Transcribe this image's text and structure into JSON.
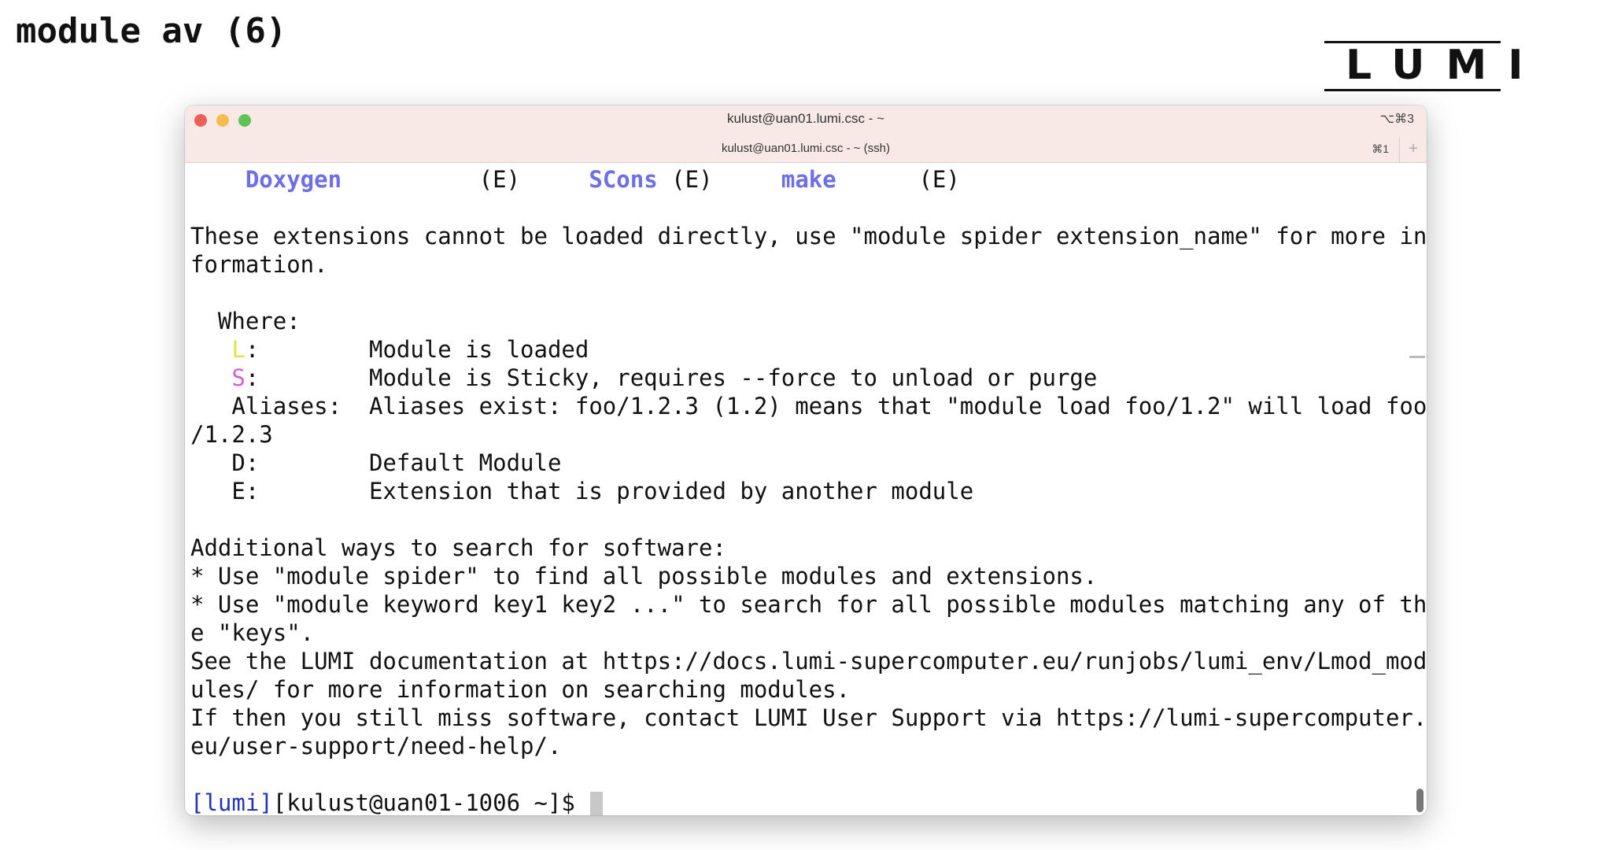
{
  "slide": {
    "title": "module av (6)",
    "logo": "LUMI"
  },
  "window": {
    "title": "kulust@uan01.lumi.csc - ~",
    "shortcut": "⌥⌘3",
    "tab": {
      "title": "kulust@uan01.lumi.csc - ~ (ssh)",
      "shortcut": "⌘1",
      "add": "+"
    }
  },
  "terminal": {
    "ext_items": [
      {
        "name": "Doxygen",
        "tag": "(E)"
      },
      {
        "name": "SCons",
        "tag": "(E)"
      },
      {
        "name": "make",
        "tag": "(E)"
      }
    ],
    "lines": [
      "These extensions cannot be loaded directly, use \"module spider extension_name\" for more in",
      "formation.",
      "",
      "  Where:",
      "   L:        Module is loaded",
      "   S:        Module is Sticky, requires --force to unload or purge",
      "   Aliases:  Aliases exist: foo/1.2.3 (1.2) means that \"module load foo/1.2\" will load foo",
      "/1.2.3",
      "   D:        Default Module",
      "   E:        Extension that is provided by another module",
      "",
      "Additional ways to search for software:",
      "* Use \"module spider\" to find all possible modules and extensions.",
      "* Use \"module keyword key1 key2 ...\" to search for all possible modules matching any of th",
      "e \"keys\".",
      "See the LUMI documentation at https://docs.lumi-supercomputer.eu/runjobs/lumi_env/Lmod_mod",
      "ules/ for more information on searching modules.",
      "If then you still miss software, contact LUMI User Support via https://lumi-supercomputer.",
      "eu/user-support/need-help/.",
      ""
    ],
    "legend_letter_L": "L",
    "legend_letter_S": "S",
    "prompt": {
      "lumi": "[lumi]",
      "rest": "[kulust@uan01-1006 ~]$ "
    }
  },
  "colors": {
    "extension_name": "#6d6ee8",
    "loaded": "#e8e04a",
    "sticky": "#d15fd6",
    "prompt_tag": "#2233bb",
    "titlebar": "#f9e9e6"
  }
}
